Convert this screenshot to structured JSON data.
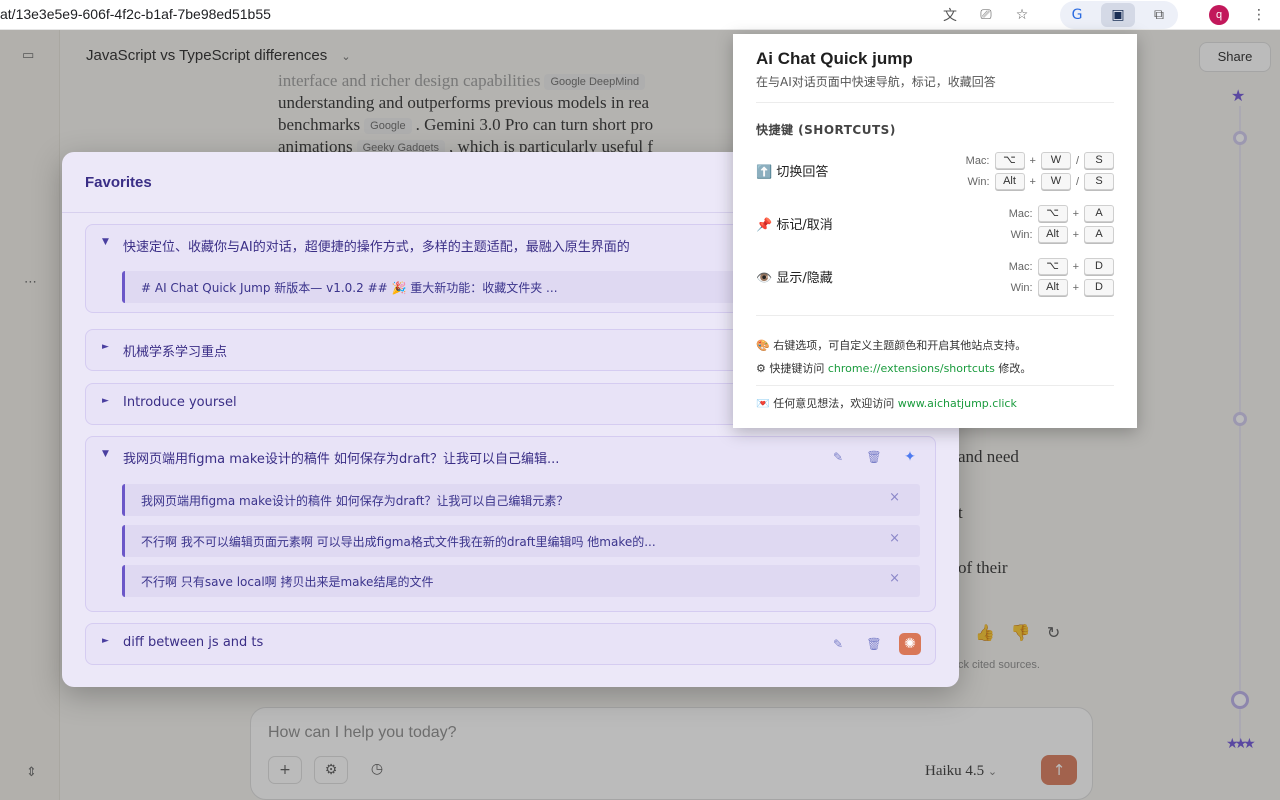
{
  "browser": {
    "url": "at/13e3e5e9-606f-4f2c-b1af-7be98ed51b55",
    "avatar_letter": "q"
  },
  "chat": {
    "title": "JavaScript vs TypeScript differences",
    "share_label": "Share",
    "lines": [
      {
        "text": "interface and richer design capabilities",
        "chip": "Google DeepMind"
      },
      {
        "text": "understanding and outperforms previous models in rea"
      },
      {
        "text": "benchmarks",
        "chip": "Google",
        "after": ". Gemini 3.0 Pro can turn short pro"
      },
      {
        "text": "animations",
        "chip": "Geeky Gadgets",
        "after": ", which is particularly useful f"
      }
    ],
    "right_lines": [
      "and need",
      "t",
      "of their"
    ],
    "cited_note": "ck cited sources.",
    "composer_placeholder": "How can I help you today?",
    "model_label": "Haiku 4.5"
  },
  "favorites": {
    "title": "Favorites",
    "groups": [
      {
        "label": "快速定位、收藏你与AI的对话，超便捷的操作方式，多样的主题适配，最融入原生界面的",
        "expanded": true,
        "items": [
          "# AI Chat Quick Jump 新版本— v1.0.2 ## 🎉 重大新功能：收藏文件夹 ..."
        ]
      },
      {
        "label": "机械学系学习重点",
        "expanded": false,
        "items": []
      },
      {
        "label": "Introduce yoursel",
        "expanded": false,
        "items": []
      },
      {
        "label": "我网页端用figma make设计的稿件 如何保存为draft？让我可以自己编辑...",
        "expanded": true,
        "ai": "gemini",
        "items": [
          "我网页端用figma make设计的稿件 如何保存为draft？让我可以自己编辑元素？",
          "不行啊 我不可以编辑页面元素啊 可以导出成figma格式文件我在新的draft里编辑吗 他make的...",
          "不行啊 只有save local啊 拷贝出来是make结尾的文件"
        ]
      },
      {
        "label": "diff between js and ts",
        "expanded": false,
        "ai": "claude",
        "items": []
      }
    ]
  },
  "popup": {
    "title": "Ai Chat Quick jump",
    "subtitle": "在与AI对话页面中快速导航，标记，收藏回答",
    "shortcuts_heading": "快捷键 (SHORTCUTS)",
    "shortcuts": [
      {
        "icon": "⬆️",
        "name": "切换回答",
        "mac": [
          "⌥",
          "W",
          "S"
        ],
        "win": [
          "Alt",
          "W",
          "S"
        ]
      },
      {
        "icon": "📌",
        "name": "标记/取消",
        "mac": [
          "⌥",
          "A"
        ],
        "win": [
          "Alt",
          "A"
        ]
      },
      {
        "icon": "👁️",
        "name": "显示/隐藏",
        "mac": [
          "⌥",
          "D"
        ],
        "win": [
          "Alt",
          "D"
        ]
      }
    ],
    "mac_label": "Mac:",
    "win_label": "Win:",
    "note1": "右键选项，可自定义主题颜色和开启其他站点支持。",
    "note2_prefix": "快捷键访问 ",
    "note2_link": "chrome://extensions/shortcuts",
    "note2_suffix": " 修改。",
    "note3_prefix": "任何意见想法，欢迎访问 ",
    "note3_link": "www.aichatjump.click"
  }
}
